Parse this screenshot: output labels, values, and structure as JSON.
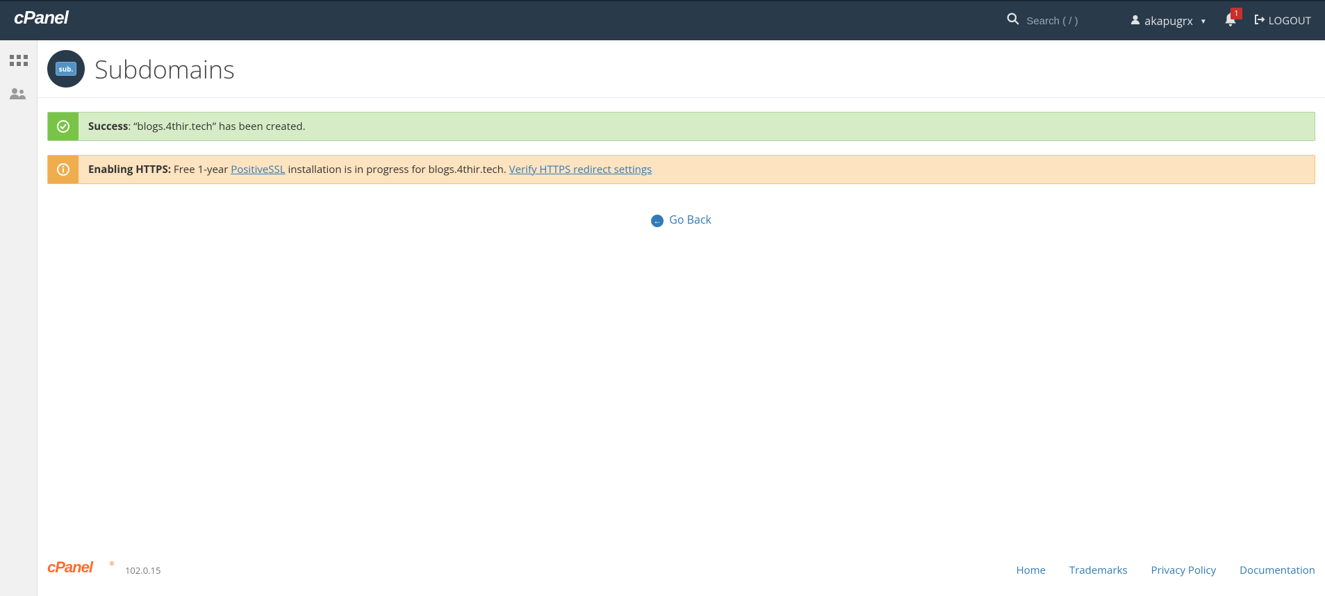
{
  "header": {
    "logo_text": "cPanel",
    "search_placeholder": "Search ( / )",
    "user": "akapugrx",
    "notif_count": "1",
    "logout_label": "LOGOUT"
  },
  "page": {
    "title": "Subdomains",
    "icon_text": "sub."
  },
  "alerts": {
    "success": {
      "label": "Success",
      "message": ": “blogs.4thir.tech” has been created."
    },
    "https": {
      "label": "Enabling HTTPS:",
      "text_before": " Free 1-year ",
      "link1": "PositiveSSL",
      "text_mid": " installation is in progress for blogs.4thir.tech. ",
      "link2": "Verify HTTPS redirect settings"
    }
  },
  "go_back": {
    "label": "Go Back"
  },
  "footer": {
    "logo": "cPanel",
    "version": "102.0.15",
    "links": {
      "home": "Home",
      "trademarks": "Trademarks",
      "privacy": "Privacy Policy",
      "docs": "Documentation"
    }
  }
}
